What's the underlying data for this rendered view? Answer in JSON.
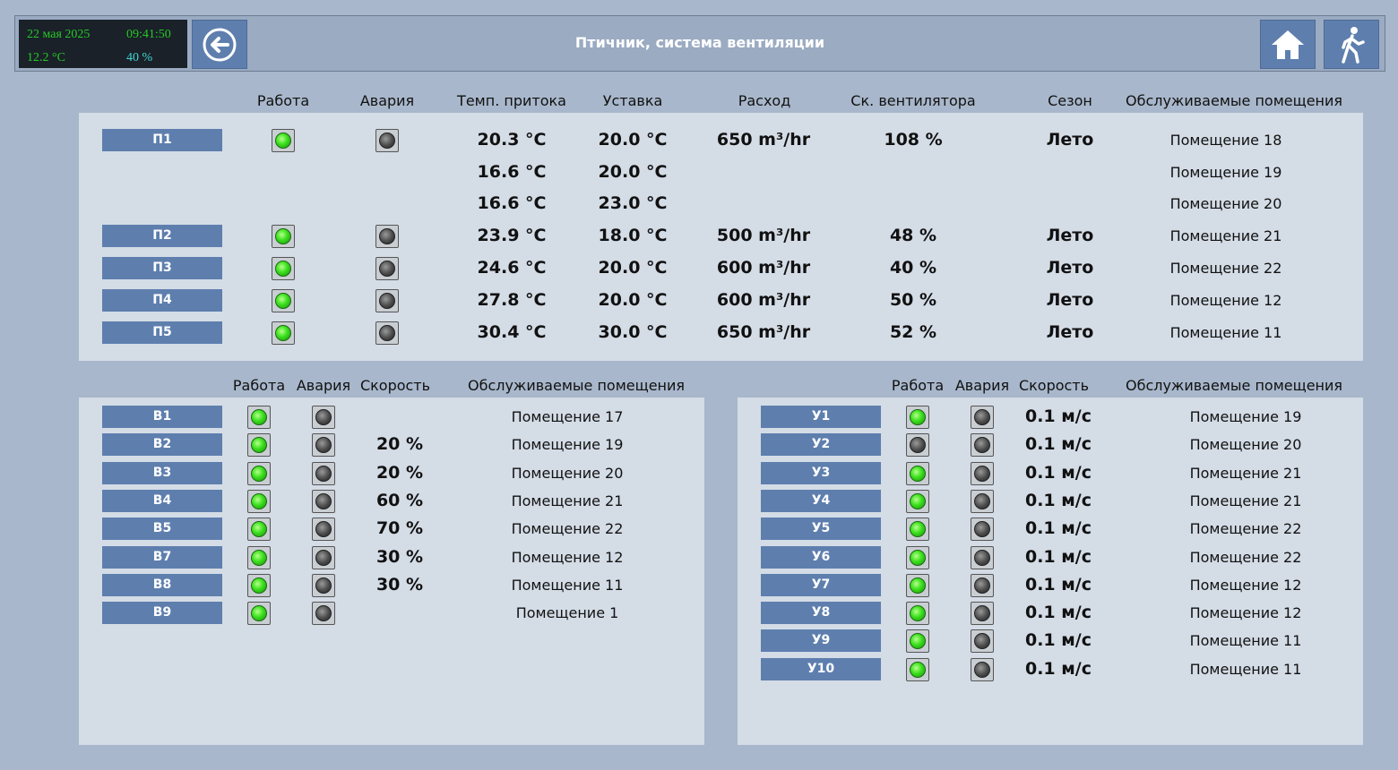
{
  "header": {
    "date": "22 мая 2025",
    "time": "09:41:50",
    "temperature": "12.2 °C",
    "humidity": "40 %",
    "title": "Птичник, система вентиляции",
    "icons": {
      "back": "arrow-left-circle-icon",
      "home": "home-icon",
      "exit": "walking-person-icon"
    }
  },
  "colors": {
    "accent": "#5e7fae",
    "background": "#a8b7cb",
    "panel": "#d4dce6",
    "led_on": "#3ae01c",
    "led_off": "#4a4a4a"
  },
  "supply": {
    "headers": [
      "Работа",
      "Авария",
      "Темп. притока",
      "Уставка",
      "Расход",
      "Ск. вентилятора",
      "Сезон",
      "Обслуживаемые помещения"
    ],
    "rows": [
      {
        "label": "П1",
        "run": true,
        "alarm": false,
        "temp": "20.3 °C",
        "setpoint": "20.0 °C",
        "flow": "650 m³/hr",
        "fan": "108 %",
        "season": "Лето",
        "room": "Помещение 18"
      },
      {
        "label": "",
        "temp": "16.6 °C",
        "setpoint": "20.0 °C",
        "flow": "",
        "fan": "",
        "season": "",
        "room": "Помещение 19"
      },
      {
        "label": "",
        "temp": "16.6 °C",
        "setpoint": "23.0 °C",
        "flow": "",
        "fan": "",
        "season": "",
        "room": "Помещение 20"
      },
      {
        "label": "П2",
        "run": true,
        "alarm": false,
        "temp": "23.9 °C",
        "setpoint": "18.0 °C",
        "flow": "500 m³/hr",
        "fan": "48 %",
        "season": "Лето",
        "room": "Помещение 21"
      },
      {
        "label": "П3",
        "run": true,
        "alarm": false,
        "temp": "24.6 °C",
        "setpoint": "20.0 °C",
        "flow": "600 m³/hr",
        "fan": "40 %",
        "season": "Лето",
        "room": "Помещение 22"
      },
      {
        "label": "П4",
        "run": true,
        "alarm": false,
        "temp": "27.8 °C",
        "setpoint": "20.0 °C",
        "flow": "600 m³/hr",
        "fan": "50 %",
        "season": "Лето",
        "room": "Помещение 12"
      },
      {
        "label": "П5",
        "run": true,
        "alarm": false,
        "temp": "30.4 °C",
        "setpoint": "30.0 °C",
        "flow": "650 m³/hr",
        "fan": "52 %",
        "season": "Лето",
        "room": "Помещение 11"
      }
    ]
  },
  "exhaust": {
    "headers": [
      "Работа",
      "Авария",
      "Скорость",
      "Обслуживаемые помещения"
    ],
    "rows": [
      {
        "label": "В1",
        "run": true,
        "alarm": false,
        "speed": "",
        "room": "Помещение 17"
      },
      {
        "label": "В2",
        "run": true,
        "alarm": false,
        "speed": "20 %",
        "room": "Помещение 19"
      },
      {
        "label": "В3",
        "run": true,
        "alarm": false,
        "speed": "20 %",
        "room": "Помещение 20"
      },
      {
        "label": "В4",
        "run": true,
        "alarm": false,
        "speed": "60 %",
        "room": "Помещение 21"
      },
      {
        "label": "В5",
        "run": true,
        "alarm": false,
        "speed": "70 %",
        "room": "Помещение 22"
      },
      {
        "label": "В7",
        "run": true,
        "alarm": false,
        "speed": "30 %",
        "room": "Помещение 12"
      },
      {
        "label": "В8",
        "run": true,
        "alarm": false,
        "speed": "30 %",
        "room": "Помещение 11"
      },
      {
        "label": "В9",
        "run": true,
        "alarm": false,
        "speed": "",
        "room": "Помещение 1"
      }
    ]
  },
  "recirc": {
    "headers": [
      "Работа",
      "Авария",
      "Скорость",
      "Обслуживаемые помещения"
    ],
    "rows": [
      {
        "label": "У1",
        "run": true,
        "alarm": false,
        "speed": "0.1 м/с",
        "room": "Помещение 19"
      },
      {
        "label": "У2",
        "run": false,
        "alarm": false,
        "speed": "0.1 м/с",
        "room": "Помещение 20"
      },
      {
        "label": "У3",
        "run": true,
        "alarm": false,
        "speed": "0.1 м/с",
        "room": "Помещение 21"
      },
      {
        "label": "У4",
        "run": true,
        "alarm": false,
        "speed": "0.1 м/с",
        "room": "Помещение 21"
      },
      {
        "label": "У5",
        "run": true,
        "alarm": false,
        "speed": "0.1 м/с",
        "room": "Помещение 22"
      },
      {
        "label": "У6",
        "run": true,
        "alarm": false,
        "speed": "0.1 м/с",
        "room": "Помещение 22"
      },
      {
        "label": "У7",
        "run": true,
        "alarm": false,
        "speed": "0.1 м/с",
        "room": "Помещение 12"
      },
      {
        "label": "У8",
        "run": true,
        "alarm": false,
        "speed": "0.1 м/с",
        "room": "Помещение 12"
      },
      {
        "label": "У9",
        "run": true,
        "alarm": false,
        "speed": "0.1 м/с",
        "room": "Помещение 11"
      },
      {
        "label": "У10",
        "run": true,
        "alarm": false,
        "speed": "0.1 м/с",
        "room": "Помещение 11"
      }
    ]
  }
}
